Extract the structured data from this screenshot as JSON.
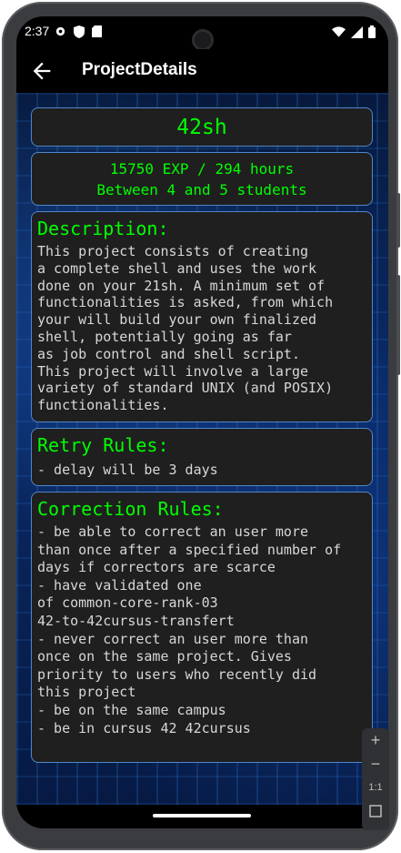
{
  "status_bar": {
    "time": "2:37"
  },
  "app_bar": {
    "title": "ProjectDetails"
  },
  "project": {
    "name": "42sh",
    "stats_line1": "15750 EXP / 294 hours",
    "stats_line2": "Between 4 and 5 students"
  },
  "description": {
    "title": "Description:",
    "text": "This project consists of creating\na complete shell and uses the work\ndone on your 21sh. A minimum set of\nfunctionalities is asked, from which\nyour will build your own finalized\nshell, potentially going as far\nas job control and shell script.\nThis project will involve a large\nvariety of standard UNIX (and POSIX)\nfunctionalities."
  },
  "retry": {
    "title": "Retry Rules:",
    "text": "- delay will be 3 days"
  },
  "correction": {
    "title": "Correction Rules:",
    "text": "- be able to correct an user more\nthan once after a specified number of\ndays if correctors are scarce\n- have validated one\nof common-core-rank-03\n42-to-42cursus-transfert\n- never correct an user more than\nonce on the same project. Gives\npriority to users who recently did\nthis project\n- be on the same campus\n- be in cursus 42 42cursus"
  },
  "zoom_controls": {
    "plus": "+",
    "minus": "−",
    "one_to_one": "1:1"
  },
  "colors": {
    "accent_green": "#00ff00",
    "card_border": "#4f86c9",
    "card_bg": "#1f1f1f"
  }
}
